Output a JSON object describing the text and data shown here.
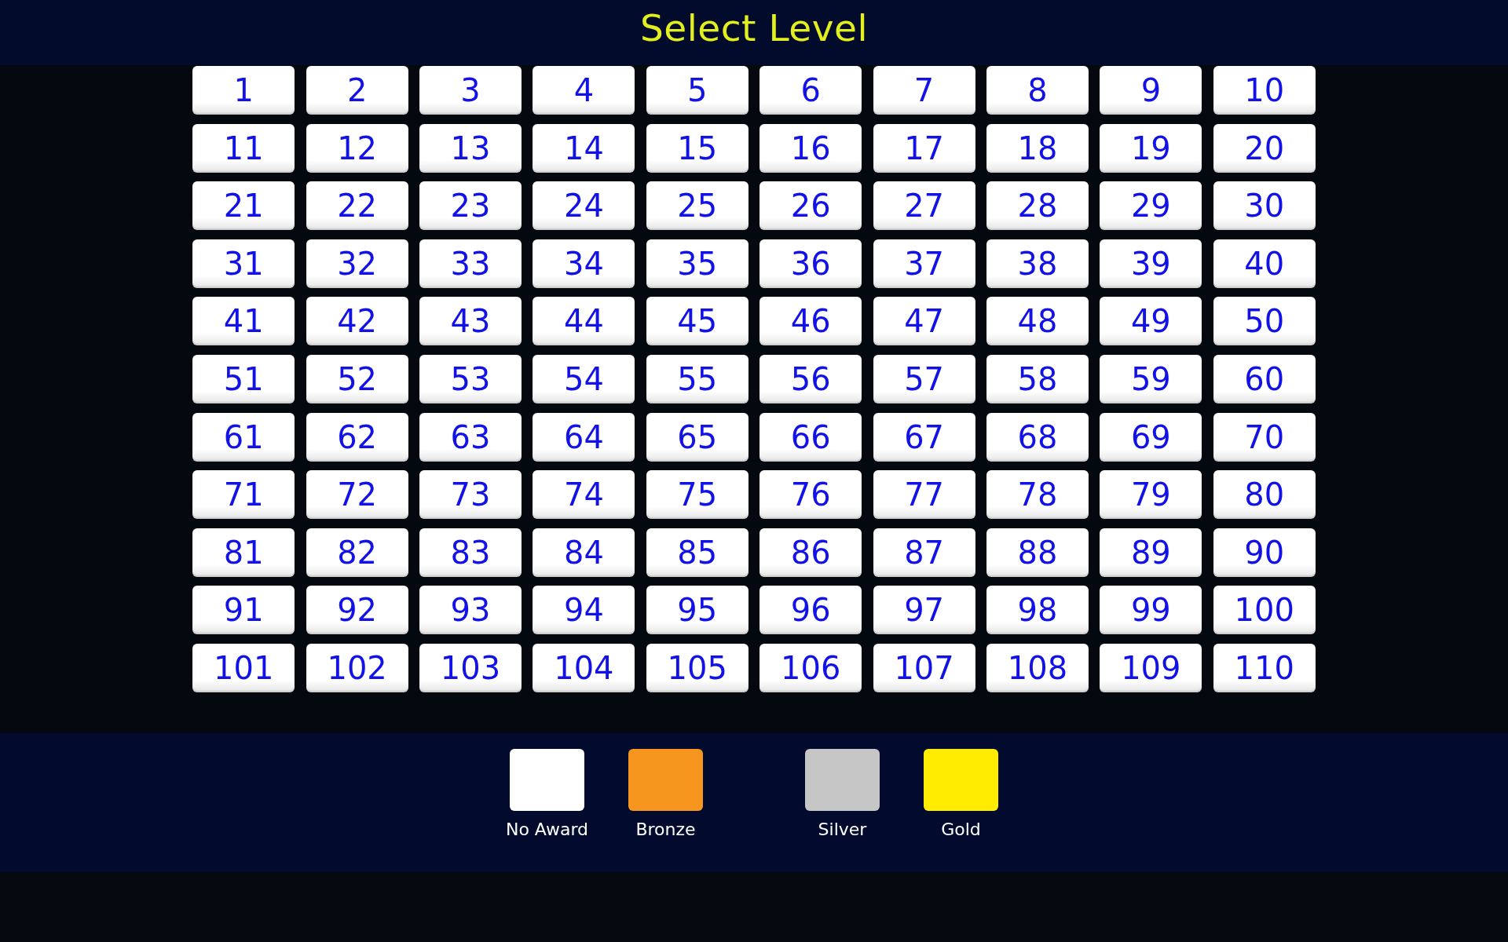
{
  "title": "Select Level",
  "levels": [
    "1",
    "2",
    "3",
    "4",
    "5",
    "6",
    "7",
    "8",
    "9",
    "10",
    "11",
    "12",
    "13",
    "14",
    "15",
    "16",
    "17",
    "18",
    "19",
    "20",
    "21",
    "22",
    "23",
    "24",
    "25",
    "26",
    "27",
    "28",
    "29",
    "30",
    "31",
    "32",
    "33",
    "34",
    "35",
    "36",
    "37",
    "38",
    "39",
    "40",
    "41",
    "42",
    "43",
    "44",
    "45",
    "46",
    "47",
    "48",
    "49",
    "50",
    "51",
    "52",
    "53",
    "54",
    "55",
    "56",
    "57",
    "58",
    "59",
    "60",
    "61",
    "62",
    "63",
    "64",
    "65",
    "66",
    "67",
    "68",
    "69",
    "70",
    "71",
    "72",
    "73",
    "74",
    "75",
    "76",
    "77",
    "78",
    "79",
    "80",
    "81",
    "82",
    "83",
    "84",
    "85",
    "86",
    "87",
    "88",
    "89",
    "90",
    "91",
    "92",
    "93",
    "94",
    "95",
    "96",
    "97",
    "98",
    "99",
    "100",
    "101",
    "102",
    "103",
    "104",
    "105",
    "106",
    "107",
    "108",
    "109",
    "110"
  ],
  "legend": [
    {
      "label": "No Award",
      "color": "#ffffff"
    },
    {
      "label": "Bronze",
      "color": "#f7961f"
    },
    {
      "label": "Silver",
      "color": "#c6c6c6"
    },
    {
      "label": "Gold",
      "color": "#ffec00"
    }
  ]
}
